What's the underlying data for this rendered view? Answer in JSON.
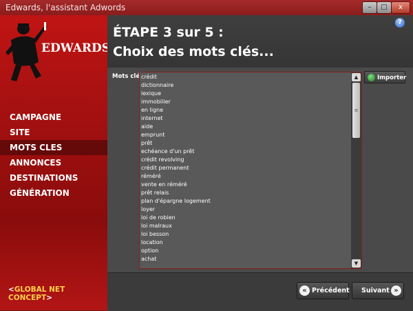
{
  "window": {
    "title": "Edwards, l'assistant Adwords",
    "minimize": "–",
    "maximize": "□",
    "close": "x"
  },
  "sidebar": {
    "logo_text": "EDWARDS",
    "items": [
      {
        "label": "CAMPAGNE",
        "active": false
      },
      {
        "label": "SITE",
        "active": false
      },
      {
        "label": "MOTS CLES",
        "active": true
      },
      {
        "label": "ANNONCES",
        "active": false
      },
      {
        "label": "DESTINATIONS",
        "active": false
      },
      {
        "label": "GÉNÉRATION",
        "active": false
      }
    ],
    "footer": {
      "left_mark": "<",
      "text": "GLOBAL NET CONCEPT",
      "right_mark": ">"
    }
  },
  "header": {
    "line1": "ÉTAPE 3 sur 5 :",
    "line2": "Choix des mots clés...",
    "help": "?"
  },
  "main": {
    "keywords_label": "Mots clés",
    "keywords": [
      "crédit",
      "dictionnaire",
      "lexique",
      "immobilier",
      "en ligne",
      "internet",
      "aide",
      "emprunt",
      "prêt",
      "echéance d'un prêt",
      "crédit revolving",
      "crédit permanent",
      "réméré",
      "vente en réméré",
      "prêt relais",
      "plan d'épargne logement",
      "loyer",
      "loi de robien",
      "loi malraux",
      "loi besson",
      "location",
      "option",
      "achat"
    ],
    "import_label": "Importer"
  },
  "footer": {
    "prev_label": "Précédent",
    "next_label": "Suivant"
  },
  "colors": {
    "sidebar_red": "#b31313",
    "panel_gray": "#4a4a4a",
    "accent_yellow": "#ffd24a"
  }
}
